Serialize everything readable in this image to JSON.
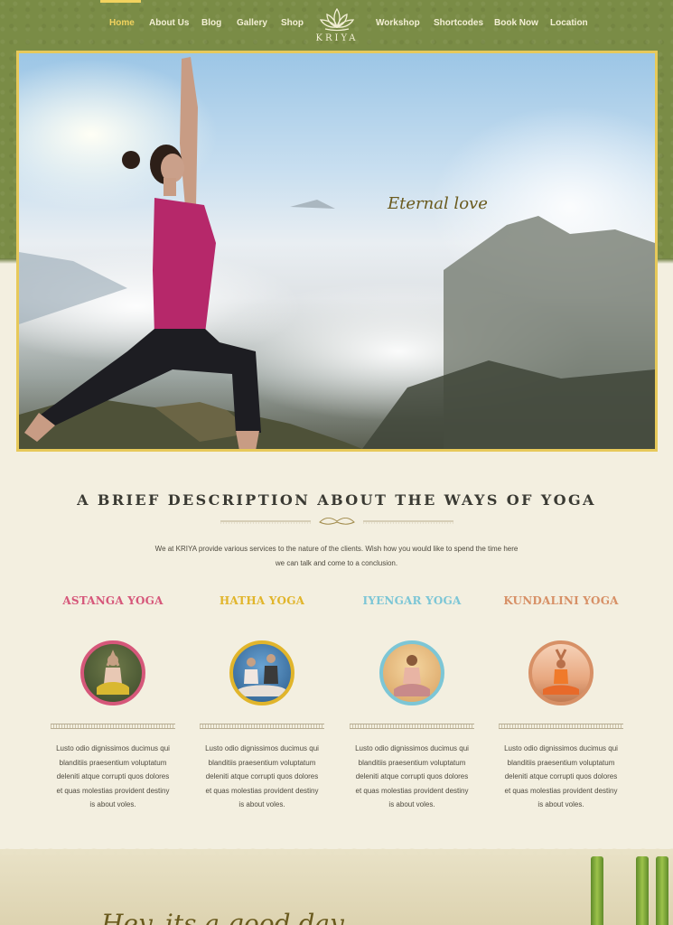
{
  "nav": {
    "items": [
      {
        "label": "Home",
        "active": true
      },
      {
        "label": "About Us"
      },
      {
        "label": "Blog"
      },
      {
        "label": "Gallery"
      },
      {
        "label": "Shop"
      },
      {
        "label": "Workshop"
      },
      {
        "label": "Shortcodes"
      },
      {
        "label": "Book Now"
      },
      {
        "label": "Location"
      }
    ],
    "logo_text": "KRIYA",
    "logo_icon": "lotus-icon"
  },
  "hero": {
    "caption": "Eternal love"
  },
  "description": {
    "heading": "A BRIEF DESCRIPTION ABOUT THE WAYS OF YOGA",
    "text_line1": "We at KRIYA provide various services to the nature of the clients. Wish how you would like to spend the time here",
    "text_line2": "we can talk and come to a conclusion."
  },
  "yoga_styles": [
    {
      "title": "ASTANGA YOGA",
      "color": "#d6577a",
      "line1": "Lusto odio dignissimos ducimus qui",
      "line2": "blanditiis praesentium voluptatum",
      "line3": "deleniti atque corrupti quos dolores",
      "line4": "et quas molestias provident destiny",
      "line5": "is about voles."
    },
    {
      "title": "HATHA YOGA",
      "color": "#e1b52b",
      "line1": "Lusto odio dignissimos ducimus qui",
      "line2": "blanditiis praesentium voluptatum",
      "line3": "deleniti atque corrupti quos dolores",
      "line4": "et quas molestias provident destiny",
      "line5": "is about voles."
    },
    {
      "title": "IYENGAR YOGA",
      "color": "#7cc6d6",
      "line1": "Lusto odio dignissimos ducimus qui",
      "line2": "blanditiis praesentium voluptatum",
      "line3": "deleniti atque corrupti quos dolores",
      "line4": "et quas molestias provident destiny",
      "line5": "is about voles."
    },
    {
      "title": "KUNDALINI YOGA",
      "color": "#d79066",
      "line1": "Lusto odio dignissimos ducimus qui",
      "line2": "blanditiis praesentium voluptatum",
      "line3": "deleniti atque corrupti quos dolores",
      "line4": "et quas molestias provident destiny",
      "line5": "is about voles."
    }
  ],
  "bottom": {
    "script_text": "Hey, its a good day"
  },
  "colors": {
    "header_green": "#7a8c46",
    "accent_gold": "#f2d35e",
    "page_beige": "#f3efe0"
  }
}
